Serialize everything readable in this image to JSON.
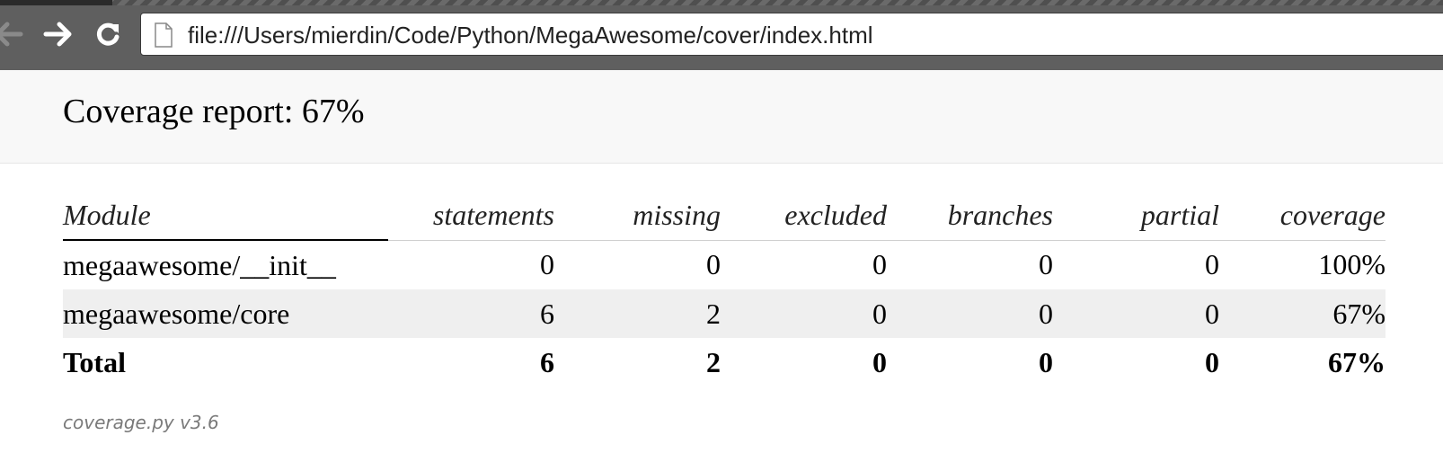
{
  "browser": {
    "url": "file:///Users/mierdin/Code/Python/MegaAwesome/cover/index.html",
    "icons": [
      "back-arrow-icon",
      "forward-arrow-icon",
      "reload-icon",
      "page-icon"
    ]
  },
  "header": {
    "title": "Coverage report: 67%"
  },
  "table": {
    "columns": [
      "Module",
      "statements",
      "missing",
      "excluded",
      "branches",
      "partial",
      "coverage"
    ],
    "rows": [
      {
        "module": "megaawesome/__init__",
        "statements": "0",
        "missing": "0",
        "excluded": "0",
        "branches": "0",
        "partial": "0",
        "coverage": "100%"
      },
      {
        "module": "megaawesome/core",
        "statements": "6",
        "missing": "2",
        "excluded": "0",
        "branches": "0",
        "partial": "0",
        "coverage": "67%"
      }
    ],
    "total": {
      "module": "Total",
      "statements": "6",
      "missing": "2",
      "excluded": "0",
      "branches": "0",
      "partial": "0",
      "coverage": "67%"
    }
  },
  "footer": {
    "text": "coverage.py v3.6"
  },
  "colors": {
    "chrome": "#5f5f5f",
    "header_bg": "#f8f8f8",
    "shaded_row": "#efefef",
    "footer_text": "#7a7a7a"
  }
}
